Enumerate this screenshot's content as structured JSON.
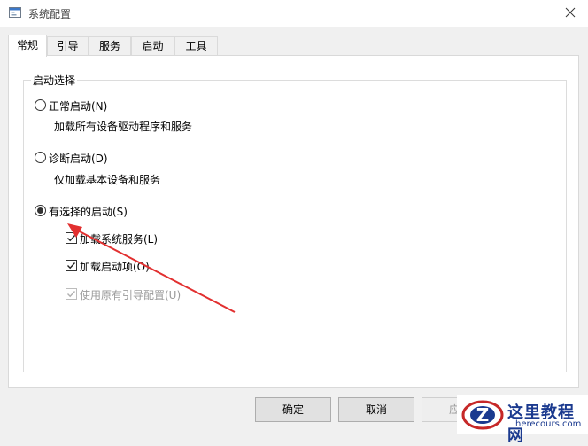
{
  "window": {
    "title": "系统配置",
    "icon": "system-config-icon",
    "close_icon": "close-icon"
  },
  "tabs": [
    {
      "label": "常规",
      "active": true
    },
    {
      "label": "引导",
      "active": false
    },
    {
      "label": "服务",
      "active": false
    },
    {
      "label": "启动",
      "active": false
    },
    {
      "label": "工具",
      "active": false
    }
  ],
  "startup_group": {
    "legend": "启动选择",
    "normal": {
      "label": "正常启动(N)",
      "description": "加载所有设备驱动程序和服务",
      "selected": false
    },
    "diagnostic": {
      "label": "诊断启动(D)",
      "description": "仅加载基本设备和服务",
      "selected": false
    },
    "selective": {
      "label": "有选择的启动(S)",
      "selected": true
    },
    "options": [
      {
        "label": "加载系统服务(L)",
        "checked": true,
        "enabled": true
      },
      {
        "label": "加载启动项(O)",
        "checked": true,
        "enabled": true
      },
      {
        "label": "使用原有引导配置(U)",
        "checked": true,
        "enabled": false
      }
    ]
  },
  "buttons": {
    "ok": "确定",
    "cancel": "取消",
    "apply": "应用"
  },
  "annotation": {
    "color": "#e23030"
  },
  "watermark": {
    "title": "这里教程网",
    "url": "herecours.com",
    "logo": "z-logo-icon"
  }
}
